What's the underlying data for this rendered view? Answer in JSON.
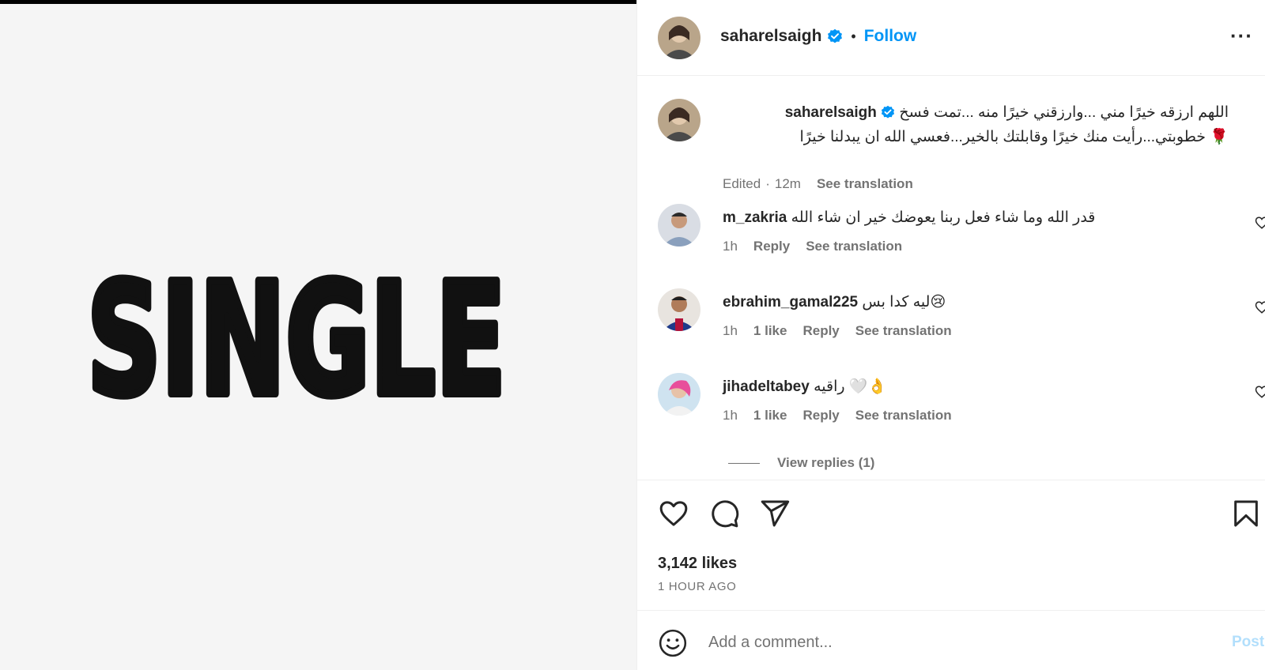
{
  "media": {
    "text": "SINGLE",
    "background_color": "#f5f5f5"
  },
  "header": {
    "username": "saharelsaigh",
    "verified": true,
    "separator": "•",
    "follow_label": "Follow",
    "more_icon": "more-horizontal-icon",
    "more_label": "···"
  },
  "caption": {
    "username": "saharelsaigh",
    "text": "اللهم ارزقه خيرًا مني ...وارزقني خيرًا منه ...تمت فسخ خطوبتي...رأيت منك خيرًا وقابلتك بالخير...فعسي الله ان يبدلنا خيرًا 🌹",
    "edited": "Edited",
    "time": "12m",
    "see_translation": "See translation"
  },
  "comments": [
    {
      "username": "m_zakria",
      "text": "قدر الله وما شاء فعل ربنا يعوضك خير ان شاء الله",
      "time": "1h",
      "likes": "",
      "reply_label": "Reply",
      "see_translation": "See translation"
    },
    {
      "username": "ebrahim_gamal225",
      "text": "ليه كدا بس😢",
      "time": "1h",
      "likes": "1 like",
      "reply_label": "Reply",
      "see_translation": "See translation"
    },
    {
      "username": "jihadeltabey",
      "text": "راقيه 🤍👌",
      "time": "1h",
      "likes": "1 like",
      "reply_label": "Reply",
      "see_translation": "See translation"
    }
  ],
  "view_replies": "View replies (1)",
  "actions": {
    "like_icon": "heart-icon",
    "comment_icon": "comment-icon",
    "share_icon": "share-icon",
    "save_icon": "bookmark-icon",
    "likes": "3,142 likes",
    "time_ago": "1 HOUR AGO"
  },
  "add_comment": {
    "emoji_icon": "emoji-icon",
    "placeholder": "Add a comment...",
    "post_label": "Post"
  },
  "colors": {
    "accent": "#0095f6",
    "muted": "#737373",
    "post_disabled": "#b2dffc"
  }
}
